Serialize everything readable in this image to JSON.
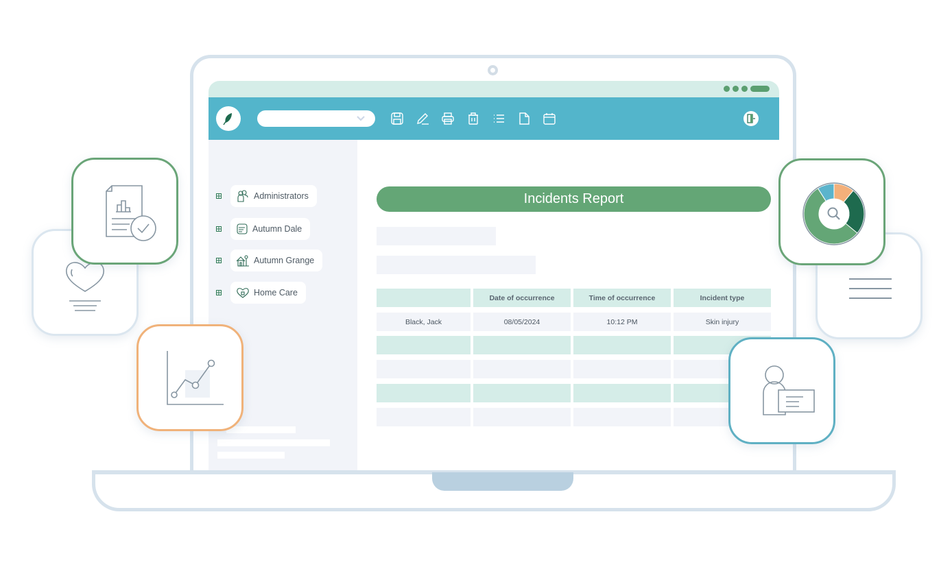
{
  "toolbar": {
    "logo_icon": "leaf-icon",
    "select_value": "",
    "icons": [
      "save-icon",
      "edit-icon",
      "print-icon",
      "delete-icon",
      "list-icon",
      "document-icon",
      "calendar-icon"
    ],
    "exit_icon": "exit-door-icon"
  },
  "sidebar": {
    "items": [
      {
        "label": "Administrators",
        "icon": "people-icon"
      },
      {
        "label": "Autumn Dale",
        "icon": "building-icon"
      },
      {
        "label": "Autumn Grange",
        "icon": "house-icon"
      },
      {
        "label": "Home Care",
        "icon": "heart-home-icon"
      }
    ]
  },
  "report": {
    "title": "Incidents Report",
    "table": {
      "headers": [
        "",
        "Date of occurrence",
        "Time of occurrence",
        "Incident type"
      ],
      "rows": [
        [
          "Black, Jack",
          "08/05/2024",
          "10:12 PM",
          "Skin injury"
        ],
        [
          "",
          "",
          "",
          ""
        ],
        [
          "",
          "",
          "",
          ""
        ],
        [
          "",
          "",
          "",
          ""
        ],
        [
          "",
          "",
          "",
          ""
        ]
      ]
    }
  },
  "colors": {
    "toolbar": "#53b5cb",
    "accent_green": "#64a676",
    "mint": "#d5ede8",
    "orange": "#f0b27a",
    "teal_border": "#5fb0c3",
    "dark_green": "#1e6a4e"
  },
  "cards": [
    {
      "name": "report-check-card",
      "icon": "report-check-icon"
    },
    {
      "name": "health-card",
      "icon": "heart-icon"
    },
    {
      "name": "line-chart-card",
      "icon": "line-chart-icon"
    },
    {
      "name": "donut-analytics-card",
      "icon": "donut-search-icon"
    },
    {
      "name": "notes-card",
      "icon": "lines-icon"
    },
    {
      "name": "user-card",
      "icon": "user-id-icon"
    }
  ]
}
